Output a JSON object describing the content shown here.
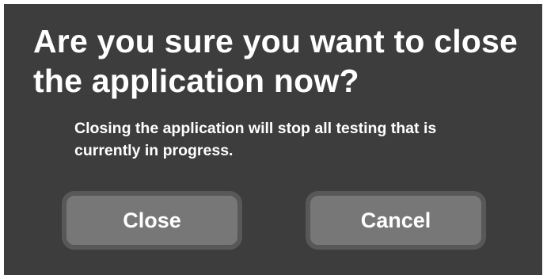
{
  "dialog": {
    "title": "Are you sure you want to close the application now?",
    "message": "Closing the application will stop all testing that is currently in progress.",
    "close_label": "Close",
    "cancel_label": "Cancel"
  },
  "colors": {
    "dialog_background": "#3d3d3d",
    "button_fill": "#777777",
    "button_border": "#585858",
    "text": "#ffffff"
  }
}
